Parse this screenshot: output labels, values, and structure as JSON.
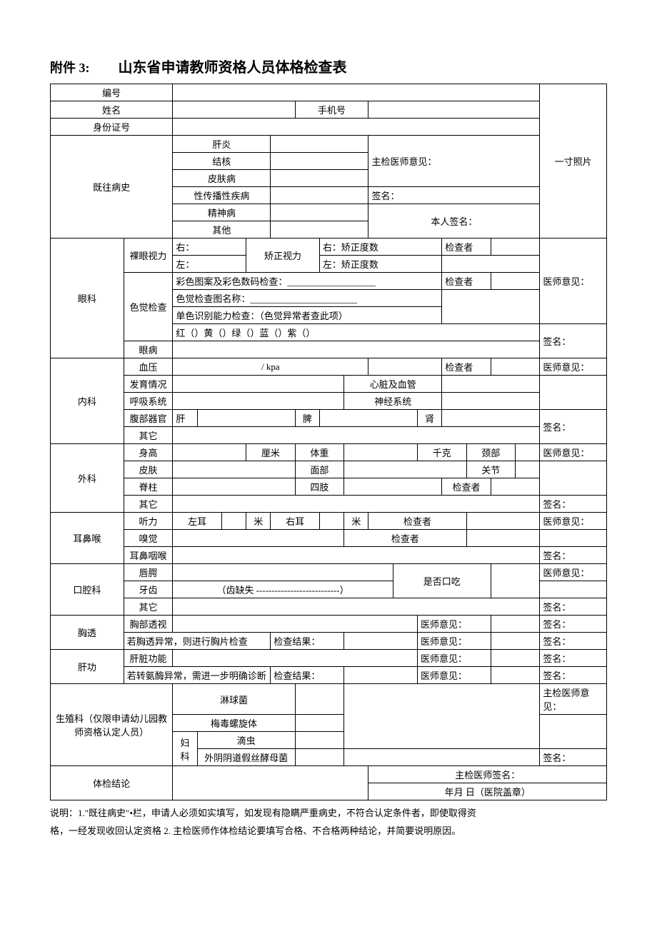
{
  "header": {
    "attach": "附件 3:",
    "title": "山东省申请教师资格人员体格检查表"
  },
  "row": {
    "no": "编号",
    "name": "姓名",
    "phone": "手机号",
    "id": "身份证号",
    "photo": "一寸照片",
    "history": "既往病史",
    "hist": {
      "ganyan": "肝炎",
      "jiehe": "结核",
      "pifu": "皮肤病",
      "xing": "性传播性疾病",
      "jingshen": "精神病",
      "qita": "其他"
    },
    "chief_opinion": "主检医师意见：",
    "sign": "签名：",
    "self_sign": "本人签名：",
    "eye": {
      "dept": "眼科",
      "naked": "裸眼视力",
      "right": "右：",
      "left": "左：",
      "corr": "矫正视力",
      "rdeg": "右：矫正度数",
      "ldeg": "左：矫正度数",
      "checker": "检查者",
      "opinion": "医师意见：",
      "color_test": "色觉检查",
      "c1": "彩色图案及彩色数码检查：___________________",
      "c2": "色觉检查图名称：_______________________",
      "c3": "单色识别能力检查：（色觉异常者查此项）",
      "c4": "红（）黄（）绿（）蓝（）紫（）",
      "disease": "眼病",
      "sign": "签名："
    },
    "internal": {
      "dept": "内科",
      "bp": "血压",
      "bp_val": "/           kpa",
      "dev": "发育情况",
      "heart": "心脏及血管",
      "resp": "呼吸系统",
      "nerve": "神经系统",
      "abd": "腹部器官",
      "liver": "肝",
      "spleen": "脾",
      "kidney": "肾",
      "other": "其它",
      "checker": "检查者",
      "opinion": "医师意见：",
      "sign": "签名："
    },
    "surgery": {
      "dept": "外科",
      "height": "身高",
      "cm": "厘米",
      "weight": "体重",
      "kg": "千克",
      "neck": "颈部",
      "skin": "皮肤",
      "face": "面部",
      "joint": "关节",
      "spine": "脊柱",
      "limbs": "四肢",
      "checker": "检查者",
      "other": "其它",
      "opinion": "医师意见：",
      "sign": "签名："
    },
    "ent": {
      "dept": "耳鼻喉",
      "hearing": "听力",
      "lear": "左耳",
      "rear": "右耳",
      "m": "米",
      "checker": "检查者",
      "smell": "嗅觉",
      "throat": "耳鼻咽喉",
      "opinion": "医师意见：",
      "sign": "签名："
    },
    "oral": {
      "dept": "口腔科",
      "lips": "唇腭",
      "stutter": "是否口吃",
      "teeth": "牙齿",
      "tooth_loss": "（齿缺失 ---------------------------）",
      "other": "其它",
      "opinion": "医师意见：",
      "sign": "签名："
    },
    "chest": {
      "dept": "胸透",
      "xray": "胸部透视",
      "abn": "若胸透异常，则进行胸片检查",
      "result": "检查结果：",
      "opinion": "医师意见：",
      "sign": "签名："
    },
    "liver": {
      "dept": "肝功",
      "func": "肝脏功能",
      "abn": "若转氨酶异常，需进一步明确诊断",
      "result": "检查结果：",
      "opinion": "医师意见：",
      "sign": "签名："
    },
    "repro": {
      "dept": "生殖科（仅限申请幼儿园教师资格认定人员）",
      "gonococcus": "淋球菌",
      "syphilis": "梅毒螺旋体",
      "gyn": "妇科",
      "trichomonas": "滴虫",
      "candida": "外阴阴道假丝酵母菌",
      "opinion": "主检医师意见：",
      "sign": "签名："
    },
    "conclusion": {
      "label": "体检结论",
      "chief_sign": "主检医师签名：",
      "date": "年月            日（医院盖章）"
    }
  },
  "notes": {
    "l1": "说明：1.\"既往病史\"•栏，申请人必须如实填写，如发现有隐瞒严重病史，不符合认定条件者，即使取得资",
    "l2": "格，一经发现收回认定资格 2. 主检医师作体检结论要填写合格、不合格两种结论，并简要说明原因。"
  }
}
